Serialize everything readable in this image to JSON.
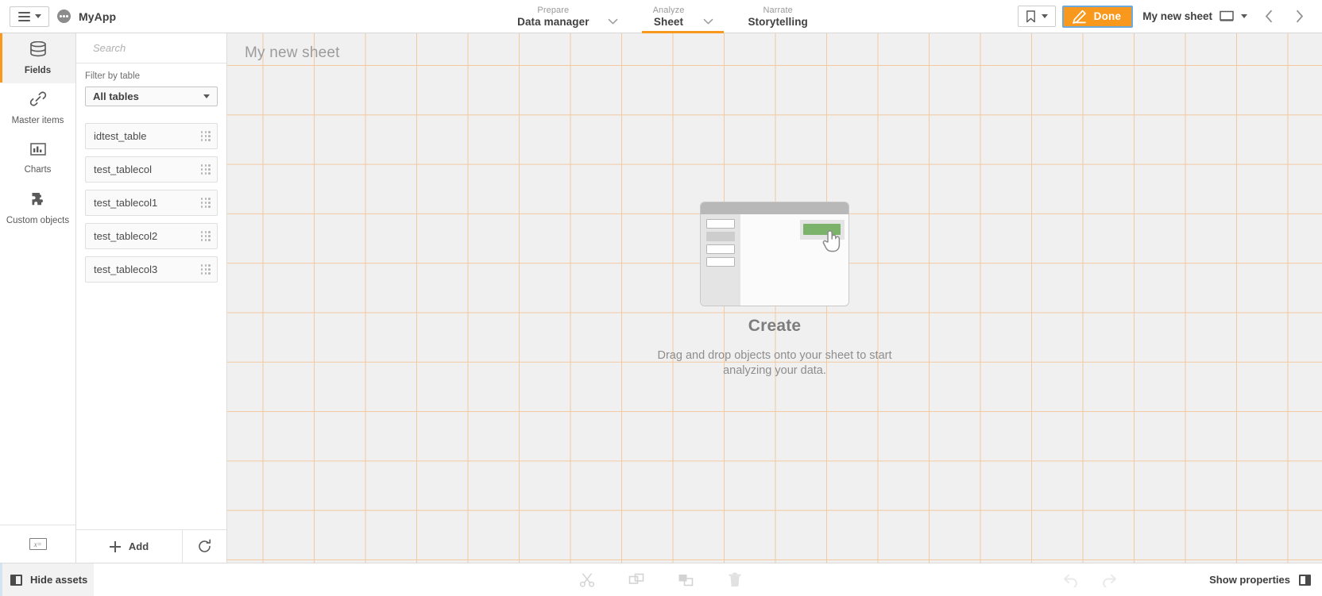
{
  "topbar": {
    "menu_button": "navigation-menu",
    "app_name": "MyApp",
    "nav": [
      {
        "over": "Prepare",
        "label": "Data manager",
        "active": false
      },
      {
        "over": "Analyze",
        "label": "Sheet",
        "active": true
      },
      {
        "over": "Narrate",
        "label": "Storytelling",
        "active": false
      }
    ],
    "bookmark_label": "bookmark-icon",
    "done_label": "Done",
    "sheet_name": "My new sheet",
    "prev_label": "previous-sheet",
    "next_label": "next-sheet"
  },
  "rail": {
    "items": [
      {
        "label": "Fields",
        "icon": "database-icon",
        "active": true
      },
      {
        "label": "Master items",
        "icon": "link-icon",
        "active": false
      },
      {
        "label": "Charts",
        "icon": "bar-chart-icon",
        "active": false
      },
      {
        "label": "Custom objects",
        "icon": "puzzle-piece-icon",
        "active": false
      }
    ],
    "bottom_icon": "expression-icon",
    "bottom_icon_text": "x="
  },
  "assets": {
    "search_placeholder": "Search",
    "search_value": "",
    "filter_label": "Filter by table",
    "filter_selected": "All tables",
    "fields": [
      {
        "name": "idtest_table"
      },
      {
        "name": "test_tablecol"
      },
      {
        "name": "test_tablecol1"
      },
      {
        "name": "test_tablecol2"
      },
      {
        "name": "test_tablecol3"
      }
    ],
    "add_label": "Add",
    "refresh_label": "refresh-icon"
  },
  "canvas": {
    "sheet_title": "My new sheet",
    "create_title": "Create",
    "create_desc": "Drag and drop objects onto your sheet to start analyzing your data.",
    "grid_color": "#f2c9a0",
    "background": "#f0f0f0",
    "accent_green": "#7cb36b"
  },
  "bottombar": {
    "hide_assets_label": "Hide assets",
    "tools": [
      {
        "name": "cut-icon"
      },
      {
        "name": "copy-icon"
      },
      {
        "name": "paste-icon"
      },
      {
        "name": "delete-icon"
      }
    ],
    "undo_label": "undo-icon",
    "redo_label": "redo-icon",
    "show_properties_label": "Show properties"
  },
  "colors": {
    "accent_orange": "#f8981d",
    "focus_blue": "#6ca9dd",
    "text_dark": "#404040",
    "text_muted": "#9a9a9a"
  }
}
